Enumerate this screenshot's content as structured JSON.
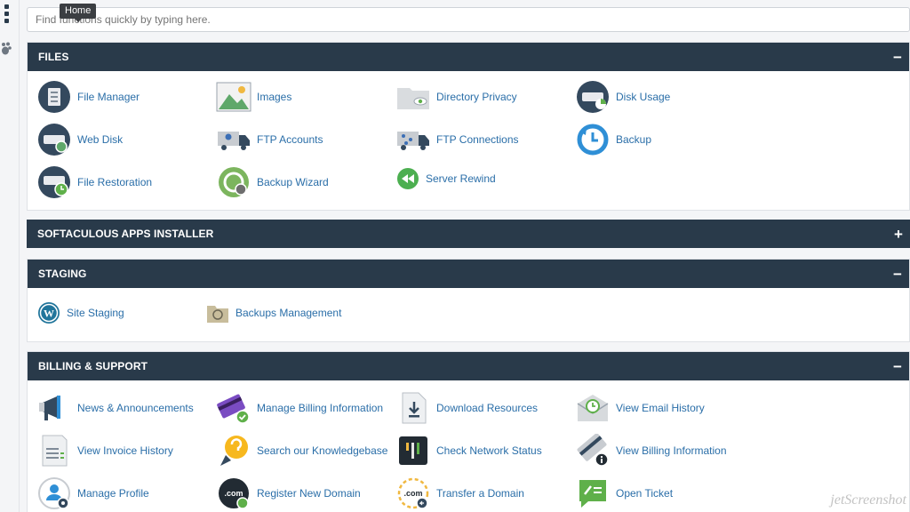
{
  "search": {
    "placeholder": "Find functions quickly by typing here."
  },
  "tooltip": "Home",
  "colors": {
    "header": "#293a4a",
    "link": "#2a6ea8",
    "accent_green": "#5fb04a",
    "accent_blue": "#2f8fd6",
    "accent_purple": "#7a4cc2"
  },
  "sections": {
    "files": {
      "title": "FILES",
      "toggle": "−",
      "items": [
        {
          "label": "File Manager",
          "icon": "file-manager-icon"
        },
        {
          "label": "Images",
          "icon": "images-icon"
        },
        {
          "label": "Directory Privacy",
          "icon": "directory-privacy-icon"
        },
        {
          "label": "Disk Usage",
          "icon": "disk-usage-icon"
        },
        {
          "label": "Web Disk",
          "icon": "web-disk-icon"
        },
        {
          "label": "FTP Accounts",
          "icon": "ftp-accounts-icon"
        },
        {
          "label": "FTP Connections",
          "icon": "ftp-connections-icon"
        },
        {
          "label": "Backup",
          "icon": "backup-icon"
        },
        {
          "label": "File Restoration",
          "icon": "file-restoration-icon"
        },
        {
          "label": "Backup Wizard",
          "icon": "backup-wizard-icon"
        },
        {
          "label": "Server Rewind",
          "icon": "server-rewind-icon"
        }
      ]
    },
    "softaculous": {
      "title": "SOFTACULOUS APPS INSTALLER",
      "toggle": "+"
    },
    "staging": {
      "title": "STAGING",
      "toggle": "−",
      "items": [
        {
          "label": "Site Staging",
          "icon": "wordpress-icon"
        },
        {
          "label": "Backups Management",
          "icon": "backups-management-icon"
        }
      ]
    },
    "billing": {
      "title": "BILLING & SUPPORT",
      "toggle": "−",
      "items": [
        {
          "label": "News & Announcements",
          "icon": "megaphone-icon"
        },
        {
          "label": "Manage Billing Information",
          "icon": "credit-card-icon"
        },
        {
          "label": "Download Resources",
          "icon": "download-icon"
        },
        {
          "label": "View Email History",
          "icon": "email-history-icon"
        },
        {
          "label": "View Invoice History",
          "icon": "invoice-icon"
        },
        {
          "label": "Search our Knowledgebase",
          "icon": "lightbulb-icon"
        },
        {
          "label": "Check Network Status",
          "icon": "network-status-icon"
        },
        {
          "label": "View Billing Information",
          "icon": "billing-info-icon"
        },
        {
          "label": "Manage Profile",
          "icon": "profile-icon"
        },
        {
          "label": "Register New Domain",
          "icon": "register-domain-icon"
        },
        {
          "label": "Transfer a Domain",
          "icon": "transfer-domain-icon"
        },
        {
          "label": "Open Ticket",
          "icon": "ticket-icon"
        }
      ]
    }
  },
  "watermark": "jetScreenshot"
}
